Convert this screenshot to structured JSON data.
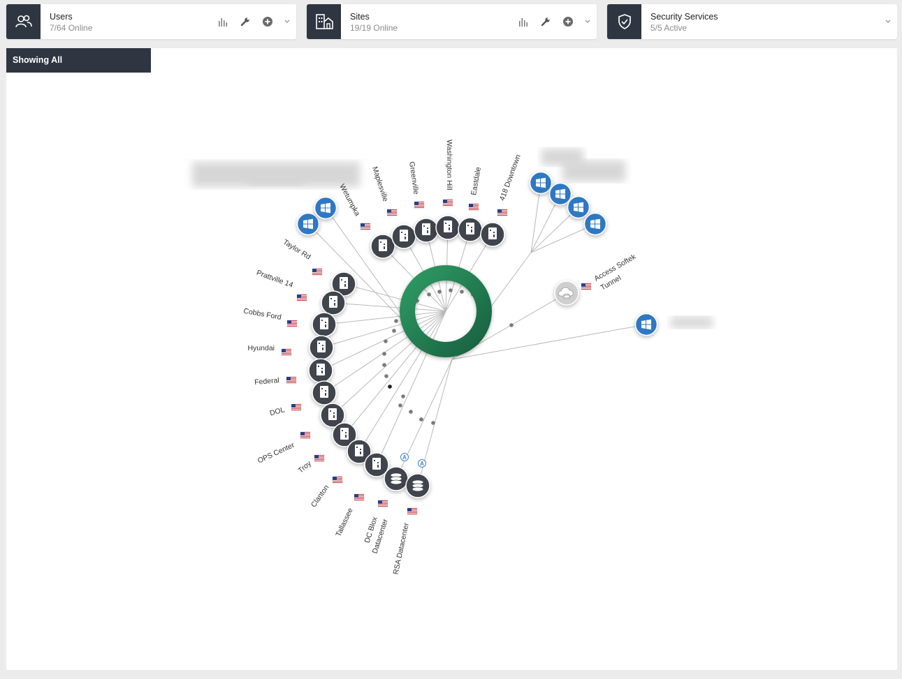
{
  "cards": {
    "users": {
      "title": "Users",
      "status": "7/64 Online",
      "icon": "users-icon"
    },
    "sites": {
      "title": "Sites",
      "status": "19/19 Online",
      "icon": "building-icon"
    },
    "security": {
      "title": "Security Services",
      "status": "5/5 Active",
      "icon": "shield-check-icon"
    }
  },
  "filter": {
    "label": "Showing All"
  },
  "topology": {
    "sites": [
      "Taylor Rd",
      "Prattville 14",
      "Cobbs Ford",
      "Hyundai",
      "Federal",
      "DOL",
      "OPS Center",
      "Troy",
      "Clanton",
      "Tallassee",
      "Wetumpka",
      "Maplesville",
      "Greenville",
      "Washington Hill",
      "Eastdale",
      "418 Downtown"
    ],
    "datacenters": [
      "DC Blox Datacenter",
      "RSA Datacenter"
    ],
    "datacenter_badge": "A",
    "tunnel": "Access Softek Tunnel",
    "colors": {
      "hub": "#1f7a4a",
      "node": "#3f454d",
      "windows": "#2f78c4"
    }
  }
}
